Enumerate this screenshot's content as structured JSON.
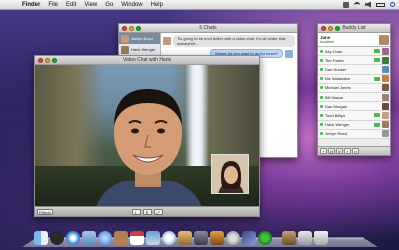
{
  "menubar": {
    "apple_glyph": "",
    "app_name": "Finder",
    "items": [
      "File",
      "Edit",
      "View",
      "Go",
      "Window",
      "Help"
    ]
  },
  "chat_window": {
    "title": "5 Chats",
    "conversations": [
      {
        "name": "Jaclyn Boyd",
        "selected": true
      },
      {
        "name": "Hank Wenger",
        "selected": false
      },
      {
        "name": "",
        "selected": false
      }
    ],
    "messages": [
      {
        "text": "Tis going to be a lot better with a video chat. It's all under that sweatshirt...",
        "style": "grey"
      },
      {
        "text": "Where do you want to go for lunch?",
        "style": "blue"
      },
      {
        "text": "",
        "style": "grey"
      }
    ]
  },
  "buddy_list": {
    "title": "Buddy List",
    "me": {
      "name": "Jane",
      "status": "Available"
    },
    "buddies": [
      {
        "name": "Ally Chan"
      },
      {
        "name": "Tim Foster"
      },
      {
        "name": "Dan Hooker"
      },
      {
        "name": "Nic Watanabe"
      },
      {
        "name": "Michael Jones"
      },
      {
        "name": "Bill Hasan"
      },
      {
        "name": "Dan Morgan"
      },
      {
        "name": "Todd Billips"
      },
      {
        "name": "Hank Wenger"
      },
      {
        "name": "Jevlyn Reed"
      }
    ],
    "toolbar_icons": [
      "add-icon",
      "at-icon",
      "phone-icon",
      "camera-icon",
      "screen-share-icon"
    ]
  },
  "video_window": {
    "title": "Video Chat with Hank",
    "effects_label": "Effects",
    "controls": [
      "mute",
      "end",
      "fullscreen"
    ]
  },
  "dock": {
    "icons": [
      "finder",
      "dashboard",
      "safari",
      "mail",
      "ichat",
      "address-book",
      "ical",
      "preview",
      "itunes",
      "iphoto",
      "imovie",
      "garageband",
      "system-preferences",
      "spaces",
      "time-machine",
      "stacks",
      "documents",
      "trash"
    ]
  },
  "colors": {
    "accent": "#1aab29",
    "selection": "#7a8aa3",
    "bubble_blue": "#bcd8f6"
  }
}
